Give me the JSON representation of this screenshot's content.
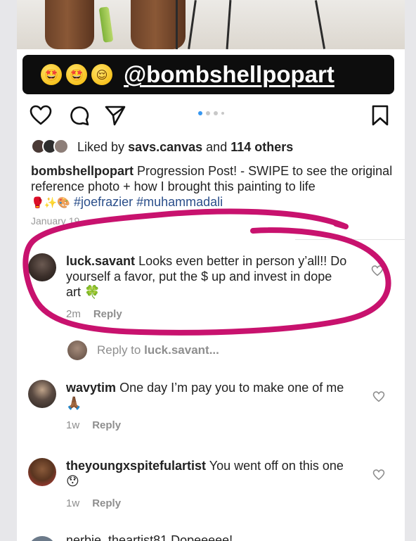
{
  "banner": {
    "emojis": [
      "🤩",
      "🤩",
      "😌"
    ],
    "handle": "@bombshellpopart"
  },
  "likes": {
    "prefix": "Liked by",
    "user": "savs.canvas",
    "and": "and",
    "others": "114 others"
  },
  "caption": {
    "user": "bombshellpopart",
    "text": "Progression Post! - SWIPE to see the original reference photo + how I brought this painting to life",
    "emojis": "🥊✨🎨",
    "tags": "#joefrazier #muhammadali"
  },
  "post_date": "January 19",
  "comments": [
    {
      "user": "luck.savant",
      "text": "Looks even better in person y’all!! Do yourself a favor, put the $ up and invest in dope art 🍀",
      "time": "2m",
      "reply": "Reply"
    },
    {
      "user": "wavytim",
      "text": "One day I’m pay you to make one of me🙏🏾",
      "time": "1w",
      "reply": "Reply"
    },
    {
      "user": "theyoungxspitefulartist",
      "text": "You went off on this one 😯",
      "time": "1w",
      "reply": "Reply"
    }
  ],
  "reply_to": {
    "prefix": "Reply to",
    "user": "luck.savant..."
  },
  "cutoff_comment": "nerbie_theartist81 Dopeeeee!",
  "icons": [
    "heart-icon",
    "comment-icon",
    "share-icon",
    "bookmark-icon"
  ],
  "colors": {
    "annotation": "#c8126e",
    "hashtag": "#2a4e8a",
    "carousel_active": "#3797f0"
  }
}
